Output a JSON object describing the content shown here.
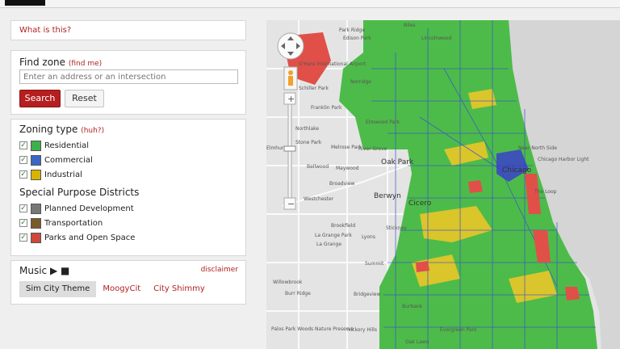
{
  "header": {
    "logo": "logo"
  },
  "whatis": {
    "label": "What is this?"
  },
  "find": {
    "title": "Find zone",
    "find_me": "(find me)",
    "placeholder": "Enter an address or an intersection",
    "search_label": "Search",
    "reset_label": "Reset"
  },
  "zoning": {
    "title": "Zoning type",
    "huh": "(huh?)",
    "types": [
      {
        "label": "Residential",
        "color": "#3cb04a",
        "checked": true
      },
      {
        "label": "Commercial",
        "color": "#3a67c4",
        "checked": true
      },
      {
        "label": "Industrial",
        "color": "#d8b400",
        "checked": true
      }
    ],
    "special_title": "Special Purpose Districts",
    "special": [
      {
        "label": "Planned Development",
        "color": "#777777",
        "checked": true
      },
      {
        "label": "Transportation",
        "color": "#7b5a2a",
        "checked": true
      },
      {
        "label": "Parks and Open Space",
        "color": "#d0463a",
        "checked": true
      }
    ]
  },
  "music": {
    "title": "Music ▶ ■",
    "disclaimer": "disclaimer",
    "tracks": [
      "Sim City Theme",
      "MoogyCit",
      "City Shimmy"
    ],
    "active": "Sim City Theme"
  },
  "map": {
    "labels": {
      "niles": "Niles",
      "lincolnwood": "Lincolnwood",
      "edison_park": "Edison Park",
      "park_ridge": "Park Ridge",
      "ohare": "O'Hare International Airport",
      "norridge": "Norridge",
      "schiller_park": "Schiller Park",
      "franklin_park": "Franklin Park",
      "northlake": "Northlake",
      "elmwood_park": "Elmwood Park",
      "river_grove": "River Grove",
      "stone_park": "Stone Park",
      "melrose_park": "Melrose Park",
      "elmhurst": "Elmhurst",
      "bellwood": "Bellwood",
      "maywood": "Maywood",
      "oak_park": "Oak Park",
      "broadview": "Broadview",
      "westchester": "Westchester",
      "berwyn": "Berwyn",
      "cicero": "Cicero",
      "brookfield": "Brookfield",
      "la_grange_park": "La Grange Park",
      "lyons": "Lyons",
      "stickney": "Stickney",
      "la_grange": "La Grange",
      "summit": "Summit",
      "willowbrook": "Willowbrook",
      "burr_ridge": "Burr Ridge",
      "bridgeview": "Bridgeview",
      "burbank": "Burbank",
      "palos_park_woods": "Palos Park Woods Nature Preserve",
      "oak_lawn": "Oak Lawn",
      "evergreen_park": "Evergreen Park",
      "hickory_hills": "Hickory Hills",
      "chicago": "Chicago",
      "near_north_side": "Near North Side",
      "chicago_harbor": "Chicago Harbor Light",
      "the_loop": "The Loop"
    }
  }
}
